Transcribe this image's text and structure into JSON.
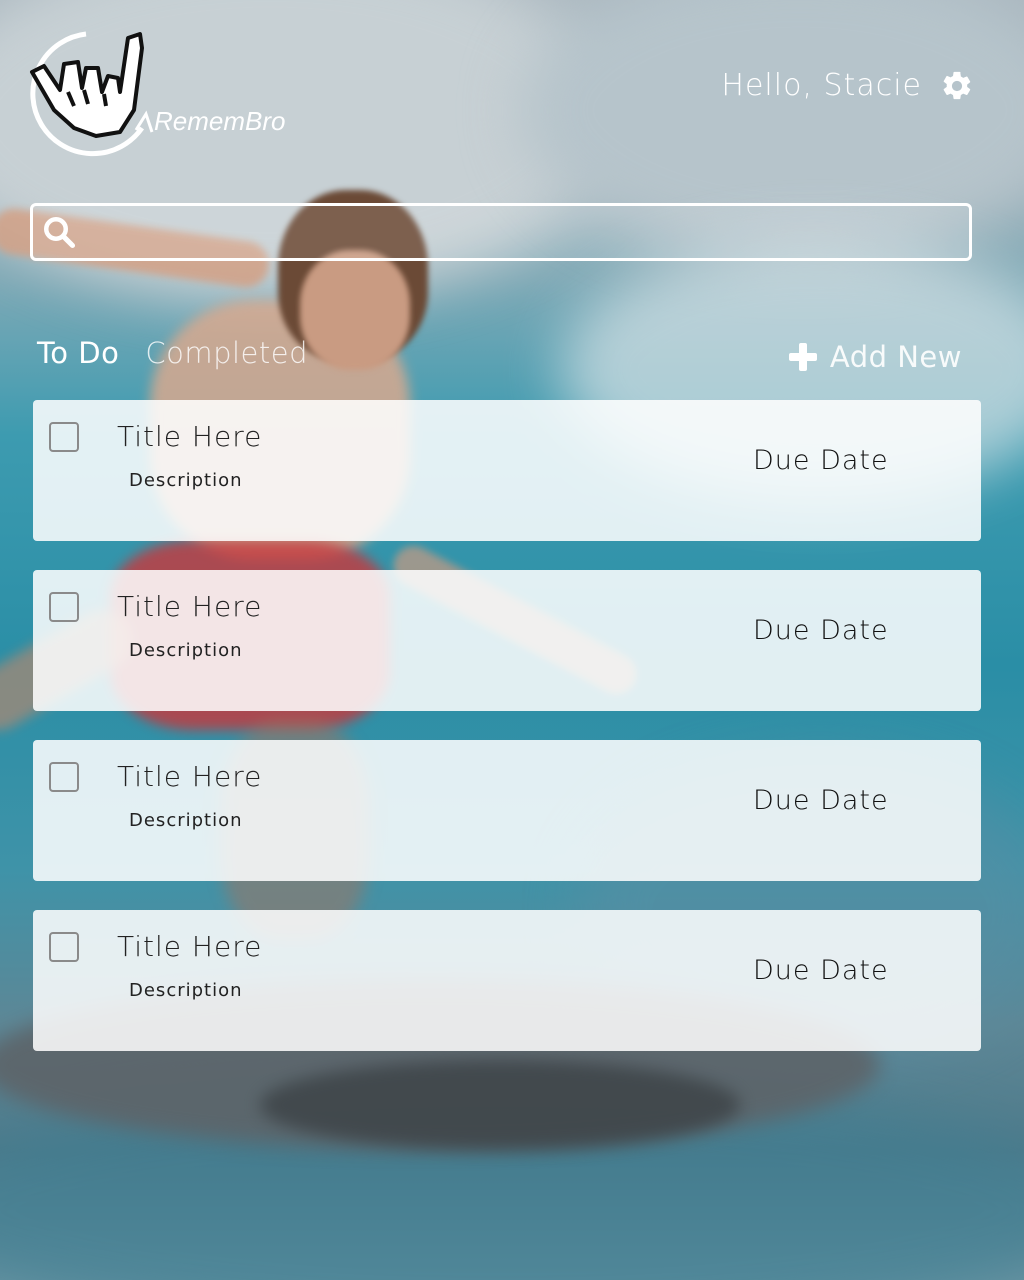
{
  "app": {
    "name": "RememBro",
    "logo_icon": "shaka-hand-icon"
  },
  "header": {
    "greeting": "Hello, Stacie",
    "settings_icon": "gear-icon"
  },
  "search": {
    "placeholder": "",
    "value": "",
    "icon": "search-icon"
  },
  "tabs": [
    {
      "label": "To Do",
      "active": true
    },
    {
      "label": "Completed",
      "active": false
    }
  ],
  "actions": {
    "add_new_label": "Add New",
    "add_new_icon": "plus-icon"
  },
  "tasks": [
    {
      "title": "Title Here",
      "description": "Description",
      "due": "Due Date",
      "checked": false
    },
    {
      "title": "Title Here",
      "description": "Description",
      "due": "Due Date",
      "checked": false
    },
    {
      "title": "Title Here",
      "description": "Description",
      "due": "Due Date",
      "checked": false
    },
    {
      "title": "Title Here",
      "description": "Description",
      "due": "Due Date",
      "checked": false
    }
  ],
  "colors": {
    "text_on_bg": "#ffffff",
    "card_bg": "#f3f4f4",
    "card_text": "#222222"
  }
}
